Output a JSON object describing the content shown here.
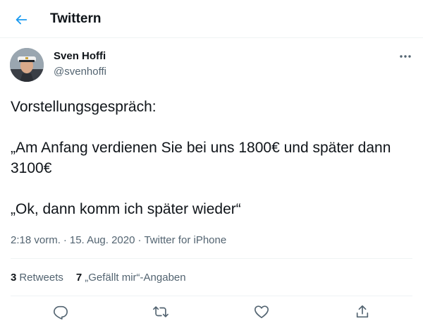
{
  "header": {
    "title": "Twittern",
    "back_icon": "arrow-left-icon"
  },
  "author": {
    "name": "Sven Hoffi",
    "handle": "@svenhoffi"
  },
  "tweet": {
    "lines": [
      "Vorstellungsgespräch:",
      "„Am Anfang verdienen Sie bei uns 1800€ und später dann 3100€",
      "„Ok, dann komm ich später wieder“"
    ]
  },
  "meta": {
    "time": "2:18 vorm.",
    "date": "15. Aug. 2020",
    "source": "Twitter for iPhone",
    "separator": "·"
  },
  "stats": {
    "retweets_count": "3",
    "retweets_label": "Retweets",
    "likes_count": "7",
    "likes_label": "„Gefällt mir“-Angaben"
  },
  "actions": [
    "reply-icon",
    "retweet-icon",
    "like-icon",
    "share-icon"
  ],
  "colors": {
    "accent": "#1d9bf0",
    "text": "#0f1419",
    "secondary": "#536471",
    "divider": "#eff3f4"
  }
}
